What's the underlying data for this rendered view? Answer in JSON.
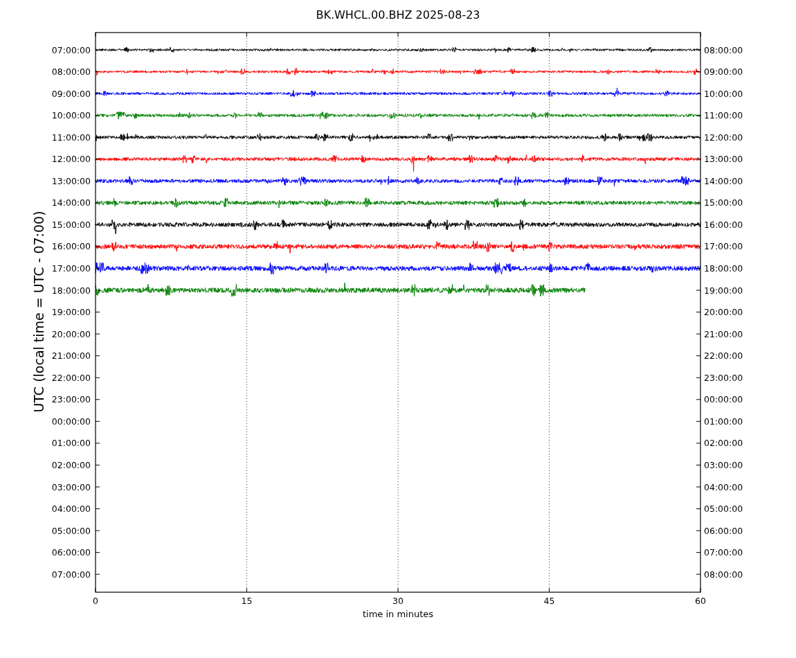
{
  "title": "BK.WHCL.00.BHZ 2025-08-23",
  "ylabel": "UTC (local time = UTC - 07:00)",
  "xlabel": "time in minutes",
  "x_ticks": [
    "0",
    "15",
    "30",
    "45",
    "60"
  ],
  "left_ticks": [
    "07:00:00",
    "08:00:00",
    "09:00:00",
    "10:00:00",
    "11:00:00",
    "12:00:00",
    "13:00:00",
    "14:00:00",
    "15:00:00",
    "16:00:00",
    "17:00:00",
    "18:00:00",
    "19:00:00",
    "20:00:00",
    "21:00:00",
    "22:00:00",
    "23:00:00",
    "00:00:00",
    "01:00:00",
    "02:00:00",
    "03:00:00",
    "04:00:00",
    "05:00:00",
    "06:00:00",
    "07:00:00"
  ],
  "right_ticks": [
    "08:00:00",
    "09:00:00",
    "10:00:00",
    "11:00:00",
    "12:00:00",
    "13:00:00",
    "14:00:00",
    "15:00:00",
    "16:00:00",
    "17:00:00",
    "18:00:00",
    "19:00:00",
    "20:00:00",
    "21:00:00",
    "22:00:00",
    "23:00:00",
    "00:00:00",
    "01:00:00",
    "02:00:00",
    "03:00:00",
    "04:00:00",
    "05:00:00",
    "06:00:00",
    "07:00:00",
    "08:00:00"
  ],
  "traces": [
    {
      "color": "#000000",
      "level": 1
    },
    {
      "color": "#ff0000",
      "level": 1
    },
    {
      "color": "#0000ff",
      "level": 1
    },
    {
      "color": "#008000",
      "level": 1
    },
    {
      "color": "#000000",
      "level": 1
    },
    {
      "color": "#ff0000",
      "level": 1
    },
    {
      "color": "#0000ff",
      "level": 1
    },
    {
      "color": "#008000",
      "level": 1
    },
    {
      "color": "#000000",
      "level": 1
    },
    {
      "color": "#ff0000",
      "level": 1
    },
    {
      "color": "#0000ff",
      "level": 1
    },
    {
      "color": "#008000",
      "level": 0.81
    }
  ]
}
